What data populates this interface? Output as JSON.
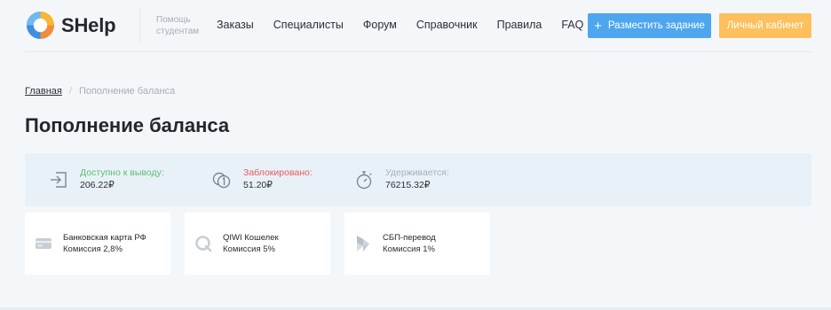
{
  "header": {
    "logo_text": "SHelp",
    "tagline": "Помощь студентам",
    "nav": [
      "Заказы",
      "Специалисты",
      "Форум",
      "Справочник",
      "Правила",
      "FAQ"
    ],
    "post_task_label": "Разместить задание",
    "cabinet_label": "Личный кабинет",
    "accent": "#4ea6ee",
    "cabinet_color": "#fdc05c"
  },
  "breadcrumb": {
    "home": "Главная",
    "separator": "/",
    "current": "Пополнение баланса"
  },
  "page_title": "Пополнение баланса",
  "balance": [
    {
      "label": "Доступно к выводу:",
      "value": "206.22₽",
      "icon": "withdraw-icon",
      "color": "#5bbf6e"
    },
    {
      "label": "Заблокировано:",
      "value": "51.20₽",
      "icon": "coins-icon",
      "color": "#e35b5b"
    },
    {
      "label": "Удерживается:",
      "value": "76215.32₽",
      "icon": "stopwatch-icon",
      "color": "#a6adb7"
    }
  ],
  "payment_methods": [
    {
      "name": "Банковская карта РФ",
      "fee": "Комиссия 2,8%",
      "icon": "bank-card-icon"
    },
    {
      "name": "QIWI Кошелек",
      "fee": "Комиссия 5%",
      "icon": "qiwi-icon"
    },
    {
      "name": "СБП-перевод",
      "fee": "Комиссия 1%",
      "icon": "sbp-icon"
    }
  ]
}
